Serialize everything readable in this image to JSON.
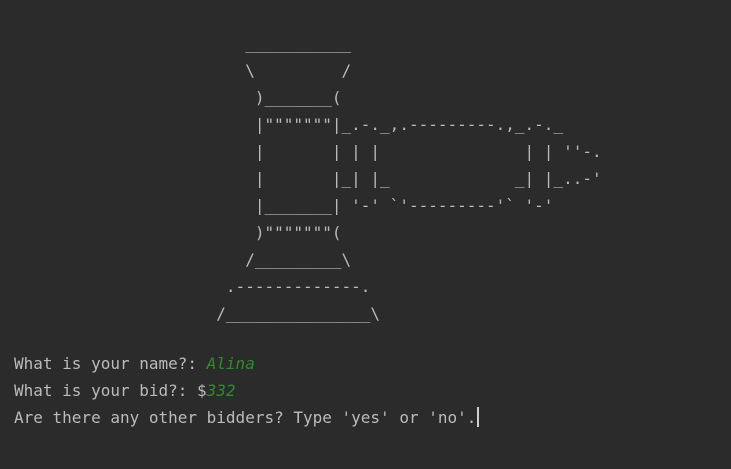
{
  "art": {
    "gavel_lines": [
      "                        ___________",
      "                        \\         /",
      "                         )_______(",
      "                         |\"\"\"\"\"\"\"|_.-._,.---------.,_.-._",
      "                         |       | | |               | | ''-.",
      "                         |       |_| |_             _| |_..-'",
      "                         |_______| '-' `'---------'` '-'",
      "                         )\"\"\"\"\"\"\"(",
      "                        /_________\\",
      "                      .-------------.",
      "                     /_______________\\"
    ]
  },
  "prompts": {
    "name_prompt": "What is your name?: ",
    "name_value": "Alina",
    "bid_prompt": "What is your bid?: $",
    "bid_value": "332",
    "bidders_prompt": "Are there any other bidders? Type 'yes' or 'no'."
  },
  "colors": {
    "background": "#2b2b2b",
    "text": "#bbbbbb",
    "user_input": "#2e8b2e"
  }
}
